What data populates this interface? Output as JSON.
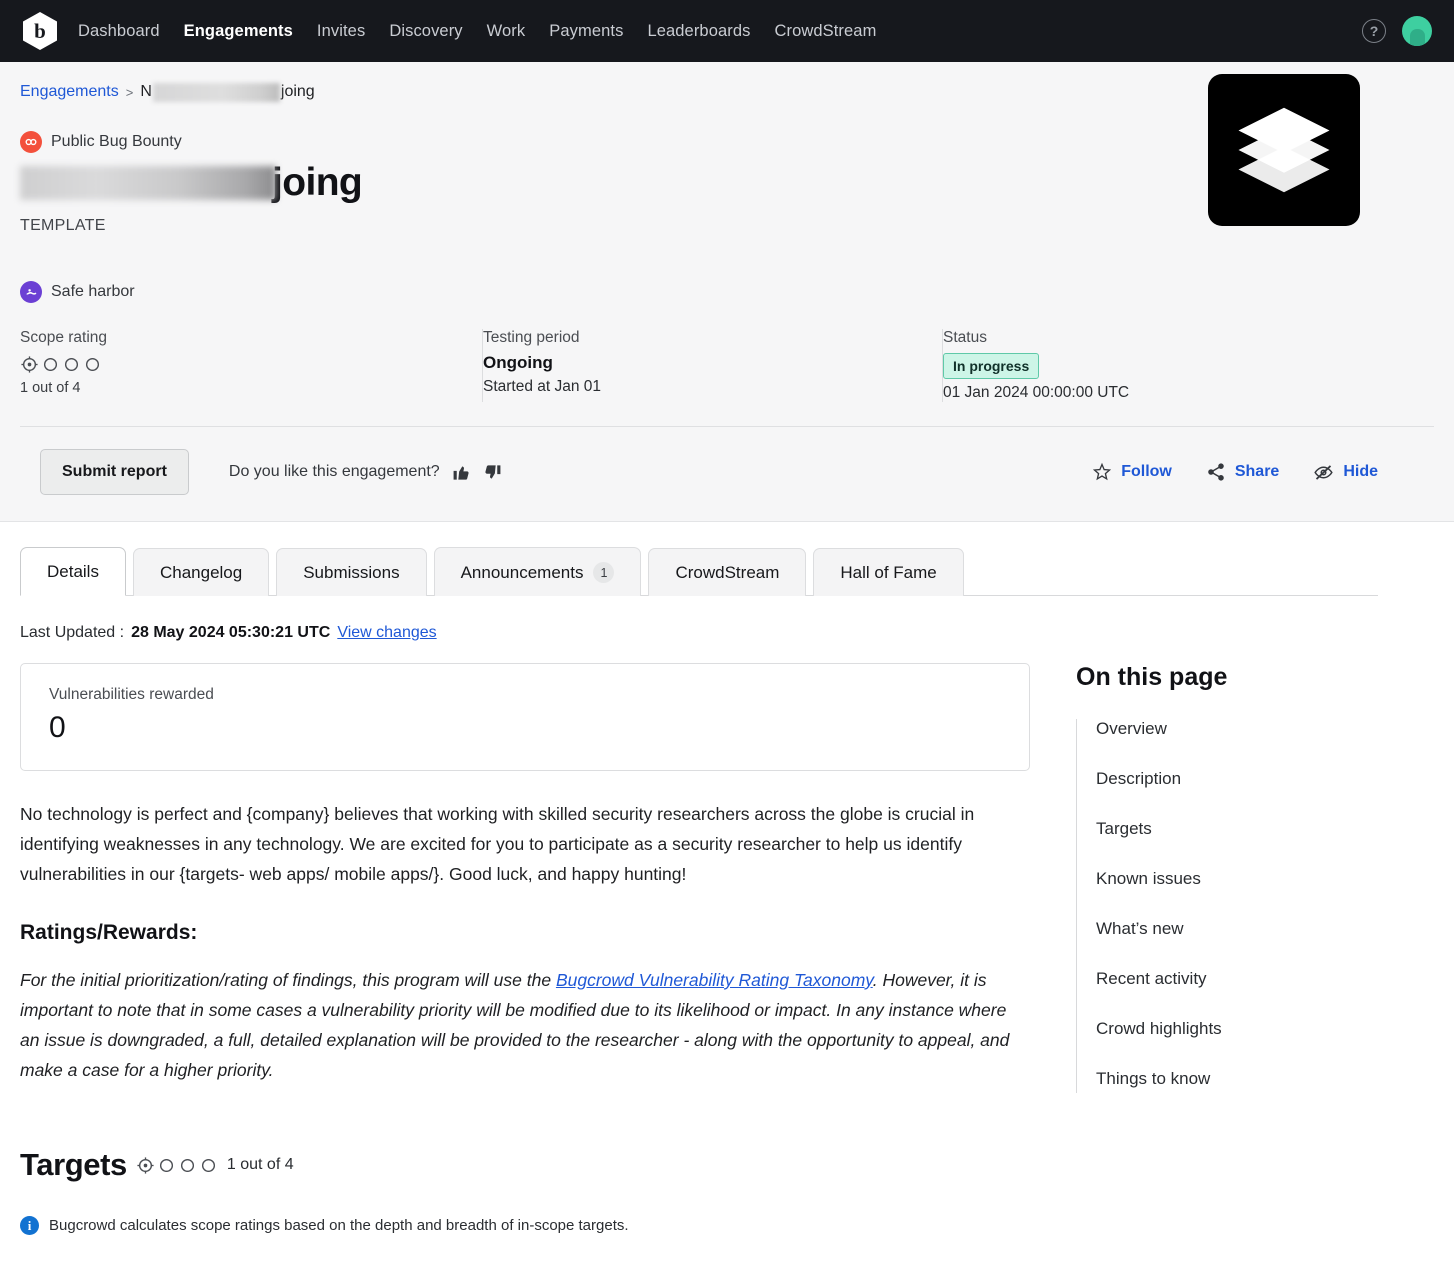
{
  "nav": {
    "logo_icon": "bugcrowd-logo-icon",
    "links": [
      {
        "label": "Dashboard",
        "active": false
      },
      {
        "label": "Engagements",
        "active": true
      },
      {
        "label": "Invites",
        "active": false
      },
      {
        "label": "Discovery",
        "active": false
      },
      {
        "label": "Work",
        "active": false
      },
      {
        "label": "Payments",
        "active": false
      },
      {
        "label": "Leaderboards",
        "active": false
      },
      {
        "label": "CrowdStream",
        "active": false
      }
    ],
    "help_glyph": "?",
    "help_icon": "help-circle-icon",
    "avatar_icon": "user-avatar",
    "avatar_color": "#3ecfa0",
    "background": "#16181d"
  },
  "breadcrumb": {
    "root": "Engagements",
    "separator": ">",
    "current_prefix": "N",
    "current_suffix": "joing",
    "current_redacted": true
  },
  "hero": {
    "program_type": "Public Bug Bounty",
    "program_type_icon": "bug-bounty-icon",
    "program_type_color": "#f3503c",
    "title_suffix": "joing",
    "title_redacted": true,
    "subtitle": "TEMPLATE",
    "safe_harbor": "Safe harbor",
    "safe_harbor_icon": "safe-harbor-shield-icon",
    "safe_harbor_color": "#6b3fd4",
    "program_logo_icon": "layers-stack-icon",
    "program_logo_bg": "#000000"
  },
  "stats": {
    "scope": {
      "label": "Scope rating",
      "filled": 1,
      "total": 4,
      "value_text": "1 out of 4",
      "icon": "scope-target-icon"
    },
    "testing_period": {
      "label": "Testing period",
      "value": "Ongoing",
      "sub": "Started at Jan 01"
    },
    "status": {
      "label": "Status",
      "badge": "In progress",
      "badge_bg": "#cdf5e7",
      "badge_border": "#5fc9a8",
      "timestamp": "01 Jan 2024 00:00:00 UTC"
    }
  },
  "actions": {
    "submit_label": "Submit report",
    "like_question": "Do you like this engagement?",
    "thumb_up_icon": "thumbs-up-icon",
    "thumb_down_icon": "thumbs-down-icon",
    "follow_label": "Follow",
    "follow_icon": "star-outline-icon",
    "share_label": "Share",
    "share_icon": "share-icon",
    "hide_label": "Hide",
    "hide_icon": "eye-slash-icon",
    "link_color": "#1f58d6"
  },
  "tabs": [
    {
      "label": "Details",
      "active": true,
      "count": null
    },
    {
      "label": "Changelog",
      "active": false,
      "count": null
    },
    {
      "label": "Submissions",
      "active": false,
      "count": null
    },
    {
      "label": "Announcements",
      "active": false,
      "count": "1"
    },
    {
      "label": "CrowdStream",
      "active": false,
      "count": null
    },
    {
      "label": "Hall of Fame",
      "active": false,
      "count": null
    }
  ],
  "details": {
    "last_updated_label": "Last Updated :",
    "last_updated_value": "28 May 2024 05:30:21 UTC",
    "view_changes_label": "View changes",
    "vulnerabilities_rewarded_label": "Vulnerabilities rewarded",
    "vulnerabilities_rewarded_value": "0",
    "intro_paragraph": "No technology is perfect and {company} believes that working with skilled security researchers across the globe is crucial in identifying weaknesses in any technology. We are excited for you to participate as a security researcher to help us identify vulnerabilities in our {targets- web apps/ mobile apps/}. Good luck, and happy hunting!",
    "ratings_heading": "Ratings/Rewards:",
    "ratings_text_before": "For the initial prioritization/rating of findings, this program will use the ",
    "ratings_link": "Bugcrowd Vulnerability Rating Taxonomy",
    "ratings_text_after": ". However, it is important to note that in some cases a vulnerability priority will be modified due to its likelihood or impact. In any instance where an issue is downgraded, a full, detailed explanation will be provided to the researcher - along with the opportunity to appeal, and make a case for a higher priority."
  },
  "on_this_page": {
    "title": "On this page",
    "items": [
      {
        "label": "Overview"
      },
      {
        "label": "Description"
      },
      {
        "label": "Targets"
      },
      {
        "label": "Known issues"
      },
      {
        "label": "What’s new"
      },
      {
        "label": "Recent activity"
      },
      {
        "label": "Crowd highlights"
      },
      {
        "label": "Things to know"
      }
    ]
  },
  "targets": {
    "title": "Targets",
    "filled": 1,
    "total": 4,
    "count_text": "1 out of 4",
    "note": "Bugcrowd calculates scope ratings based on the depth and breadth of in-scope targets.",
    "note_icon": "info-icon"
  }
}
